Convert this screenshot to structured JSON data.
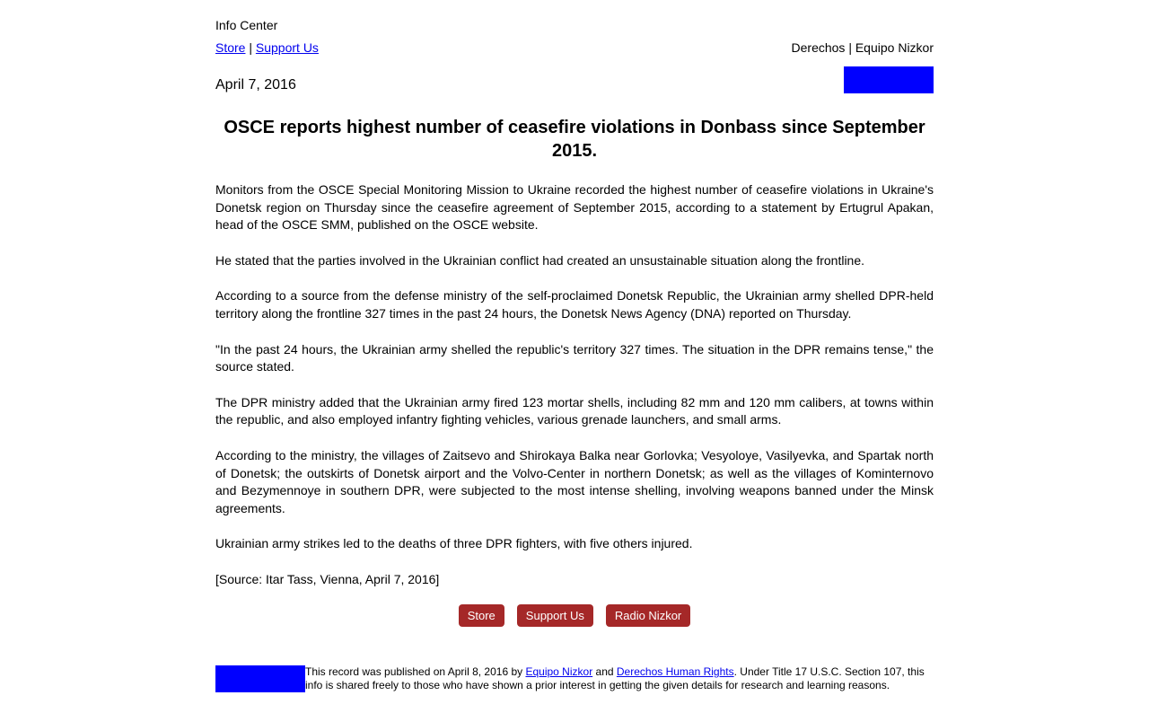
{
  "header": {
    "info_center": "Info Center",
    "store_link": "Store",
    "separator": " | ",
    "support_link": "Support Us",
    "org_name": "Derechos | Equipo Nizkor",
    "date": "April 7, 2016",
    "logo_color": "#0000ff"
  },
  "article": {
    "headline": "OSCE reports highest number of ceasefire violations in Donbass since September 2015.",
    "paragraphs": [
      "Monitors from the OSCE Special Monitoring Mission to Ukraine recorded the highest number of ceasefire violations in Ukraine's Donetsk region on Thursday since the ceasefire agreement of September 2015, according to a statement by Ertugrul Apakan, head of the OSCE SMM, published on the OSCE website.",
      "He stated that the parties involved in the Ukrainian conflict had created an unsustainable situation along the frontline.",
      "According to a source from the defense ministry of the self-proclaimed Donetsk Republic, the Ukrainian army shelled DPR-held territory along the frontline 327 times in the past 24 hours, the Donetsk News Agency (DNA) reported on Thursday.",
      "\"In the past 24 hours, the Ukrainian army shelled the republic's territory 327 times. The situation in the DPR remains tense,\" the source stated.",
      "The DPR ministry added that the Ukrainian army fired 123 mortar shells, including 82 mm and 120 mm calibers, at towns within the republic, and also employed infantry fighting vehicles, various grenade launchers, and small arms.",
      "According to the ministry, the villages of Zaitsevo and Shirokaya Balka near Gorlovka; Vesyoloye, Vasilyevka, and Spartak north of Donetsk; the outskirts of Donetsk airport and the Volvo-Center in northern Donetsk; as well as the villages of Kominternovo and Bezymennoye in southern DPR, were subjected to the most intense shelling, involving weapons banned under the Minsk agreements.",
      "Ukrainian army strikes led to the deaths of three DPR fighters, with five others injured.",
      "[Source: Itar Tass, Vienna, April 7, 2016]"
    ]
  },
  "buttons": {
    "store": "Store",
    "support": "Support Us",
    "radio": "Radio Nizkor",
    "color": "#a52828"
  },
  "footer": {
    "text_before": "This record was published on April 8, 2016 by ",
    "link1": "Equipo Nizkor",
    "and": " and ",
    "link2": "Derechos Human Rights",
    "text_after": ". Under Title 17 U.S.C. Section 107, this info is shared freely to those who have shown a prior interest in getting the given details for research and learning reasons."
  }
}
